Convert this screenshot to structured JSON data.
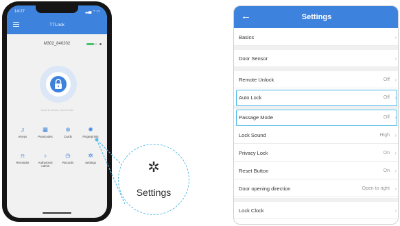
{
  "phone": {
    "status_time": "14:27",
    "status_icons": "▂▄ ◔ ▭",
    "app_title": "TTLock",
    "device_name": "M302_840202",
    "battery_level": 0.7,
    "lock_hint": "touch to unlock, hold to lock",
    "grid_items": [
      {
        "label": "eKeys",
        "icon": "♫"
      },
      {
        "label": "Passcodes",
        "icon": "▦"
      },
      {
        "label": "Cards",
        "icon": "⊗"
      },
      {
        "label": "Fingerprints",
        "icon": "✺"
      },
      {
        "label": "Reminder",
        "icon": "⍾"
      },
      {
        "label": "Authorized Admin",
        "icon": "♁"
      },
      {
        "label": "Records",
        "icon": "◷"
      },
      {
        "label": "Settings",
        "icon": "✲"
      }
    ]
  },
  "zoom": {
    "icon": "gear-icon",
    "icon_glyph": "✲",
    "label": "Settings"
  },
  "settings": {
    "title": "Settings",
    "back_glyph": "←",
    "rows": [
      {
        "label": "Basics",
        "value": "",
        "highlighted": false
      },
      {
        "label": "Door Sensor",
        "value": "",
        "highlighted": false
      },
      {
        "label": "Remote Unlock",
        "value": "Off",
        "highlighted": false
      },
      {
        "label": "Auto Lock",
        "value": "Off",
        "highlighted": true
      },
      {
        "label": "Passage Mode",
        "value": "Off",
        "highlighted": true
      },
      {
        "label": "Lock Sound",
        "value": "High",
        "highlighted": false
      },
      {
        "label": "Privacy Lock",
        "value": "On",
        "highlighted": false
      },
      {
        "label": "Reset Button",
        "value": "On",
        "highlighted": false
      },
      {
        "label": "Door opening direction",
        "value": "Open to right",
        "highlighted": false
      },
      {
        "label": "Lock Clock",
        "value": "",
        "highlighted": false
      }
    ]
  },
  "colors": {
    "brand_blue": "#3d82dc",
    "highlight": "#3fb5e6",
    "battery": "#43c46a"
  }
}
